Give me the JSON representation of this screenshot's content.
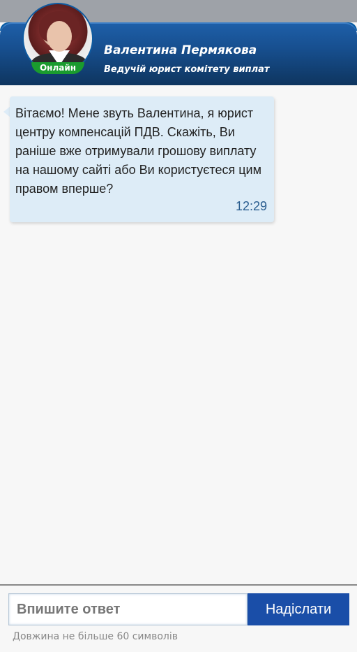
{
  "header": {
    "name": "Валентина Пермякова",
    "role": "Ведучій юрист комітету виплат",
    "status": "Онлайн"
  },
  "chat": {
    "messages": [
      {
        "text": "Вітаємо! Мене звуть Валентина, я юрист центру компенсацій ПДВ. Скажіть, Ви раніше вже отримували грошову виплату на нашому сайті або Ви користуєтеся цим правом вперше?",
        "time": "12:29"
      }
    ]
  },
  "composer": {
    "placeholder": "Впишите ответ",
    "send_label": "Надіслати",
    "hint": "Довжина не більше 60 символів"
  },
  "colors": {
    "header_blue": "#174f8f",
    "online_green": "#1a9b2e",
    "bubble": "#ddecf7",
    "send_button": "#1a4ea8"
  }
}
